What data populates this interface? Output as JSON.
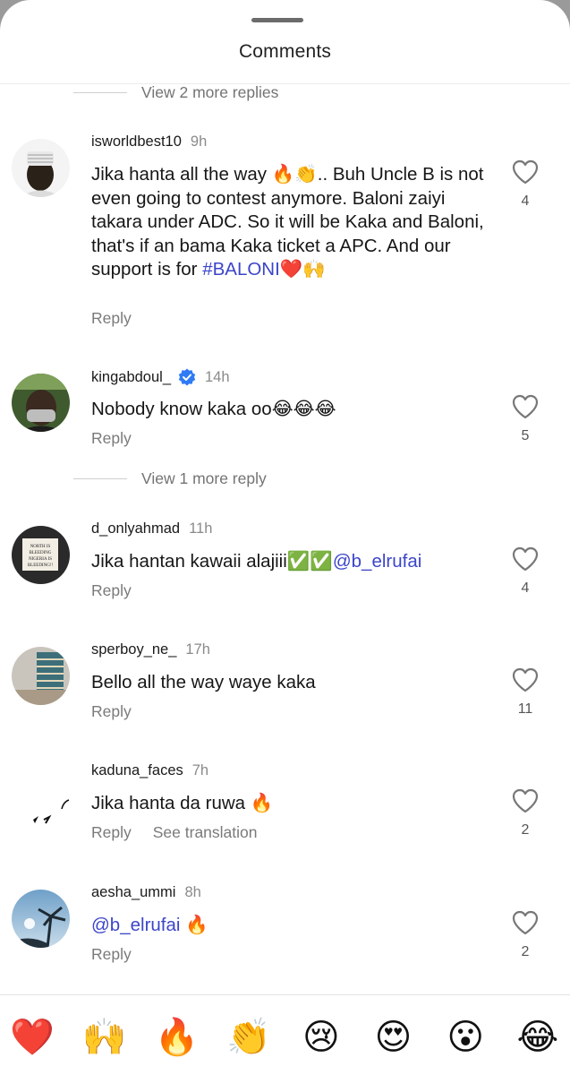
{
  "header": {
    "title": "Comments"
  },
  "view_more_top": "View 2 more replies",
  "view_more_mid": "View 1 more reply",
  "comments": [
    {
      "username": "isworldbest10",
      "time": "9h",
      "text_part1": "Jika hanta all the way 🔥👏.. Buh Uncle B is not even going to contest anymore. Baloni zaiyi takara under ADC. So it will be Kaka and Baloni, that's if an bama Kaka ticket a APC. And our support is for ",
      "hashtag": "#BALONI",
      "text_part2": "❤️🙌",
      "reply": "Reply",
      "likes": "4"
    },
    {
      "username": "kingabdoul_",
      "time": "14h",
      "text": "Nobody know kaka oo😂😂😂",
      "reply": "Reply",
      "likes": "5"
    },
    {
      "username": "d_onlyahmad",
      "time": "11h",
      "text": "Jika hantan kawaii alajiii✅✅",
      "mention": "@b_elrufai",
      "reply": "Reply",
      "likes": "4",
      "avatar_text": "NORTH IS BLEEDING NIGERIA IS BLEEDING!!"
    },
    {
      "username": "sperboy_ne_",
      "time": "17h",
      "text": "Bello all the way waye kaka",
      "reply": "Reply",
      "likes": "11"
    },
    {
      "username": "kaduna_faces",
      "time": "7h",
      "text": "Jika hanta da ruwa 🔥",
      "reply": "Reply",
      "see_translation": "See translation",
      "likes": "2"
    },
    {
      "username": "aesha_ummi",
      "time": "8h",
      "mention": "@b_elrufai",
      "text_after": " 🔥",
      "reply": "Reply",
      "likes": "2"
    }
  ],
  "emoji_bar": [
    "❤️",
    "🙌",
    "🔥",
    "👏",
    "😢",
    "😍",
    "😮",
    "😂"
  ],
  "colors": {
    "mention": "#3b45c9",
    "verified": "#2f7bf5",
    "muted": "#7a7a7a"
  }
}
